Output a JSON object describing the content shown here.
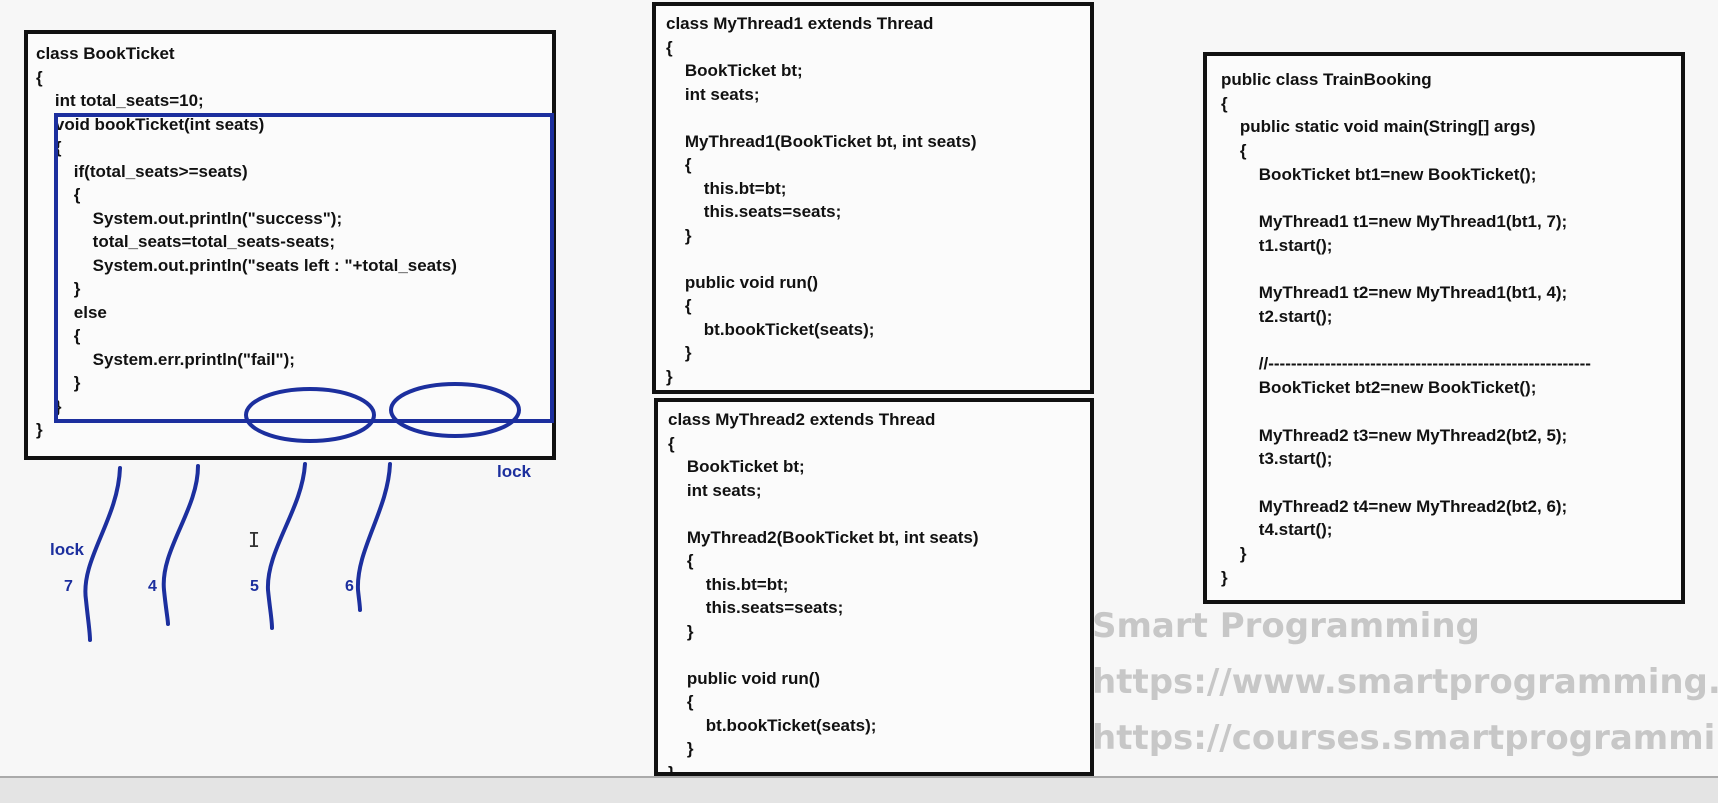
{
  "book_ticket": {
    "lines": [
      "class BookTicket",
      "{",
      "    int total_seats=10;",
      "    void bookTicket(int seats)",
      "    {",
      "        if(total_seats>=seats)",
      "        {",
      "            System.out.println(\"success\");",
      "            total_seats=total_seats-seats;",
      "            System.out.println(\"seats left : \"+total_seats)",
      "        }",
      "        else",
      "        {",
      "            System.err.println(\"fail\");",
      "        }",
      "    }",
      "}"
    ]
  },
  "mythread1": {
    "lines": [
      "class MyThread1 extends Thread",
      "{",
      "    BookTicket bt;",
      "    int seats;",
      "",
      "    MyThread1(BookTicket bt, int seats)",
      "    {",
      "        this.bt=bt;",
      "        this.seats=seats;",
      "    }",
      "",
      "    public void run()",
      "    {",
      "        bt.bookTicket(seats);",
      "    }",
      "}"
    ]
  },
  "mythread2": {
    "lines": [
      "class MyThread2 extends Thread",
      "{",
      "    BookTicket bt;",
      "    int seats;",
      "",
      "    MyThread2(BookTicket bt, int seats)",
      "    {",
      "        this.bt=bt;",
      "        this.seats=seats;",
      "    }",
      "",
      "    public void run()",
      "    {",
      "        bt.bookTicket(seats);",
      "    }",
      "}"
    ]
  },
  "train_booking": {
    "lines": [
      "public class TrainBooking",
      "{",
      "    public static void main(String[] args)",
      "    {",
      "        BookTicket bt1=new BookTicket();",
      "",
      "        MyThread1 t1=new MyThread1(bt1, 7);",
      "        t1.start();",
      "",
      "        MyThread1 t2=new MyThread1(bt1, 4);",
      "        t2.start();",
      "",
      "        //---------------------------------------------------------",
      "        BookTicket bt2=new BookTicket();",
      "",
      "        MyThread2 t3=new MyThread2(bt2, 5);",
      "        t3.start();",
      "",
      "        MyThread2 t4=new MyThread2(bt2, 6);",
      "        t4.start();",
      "    }",
      "}"
    ]
  },
  "annotations": {
    "lock_right": "lock",
    "lock_left": "lock",
    "thread_numbers": [
      "7",
      "4",
      "5",
      "6"
    ]
  },
  "watermark": {
    "brand": "Smart Programming",
    "url1": "https://www.smartprogramming.in",
    "url2": "https://courses.smartprogramming.in"
  },
  "colors": {
    "ink_blue": "#1c2f9e",
    "box_border": "#111111",
    "watermark": "#c7c7c7"
  }
}
